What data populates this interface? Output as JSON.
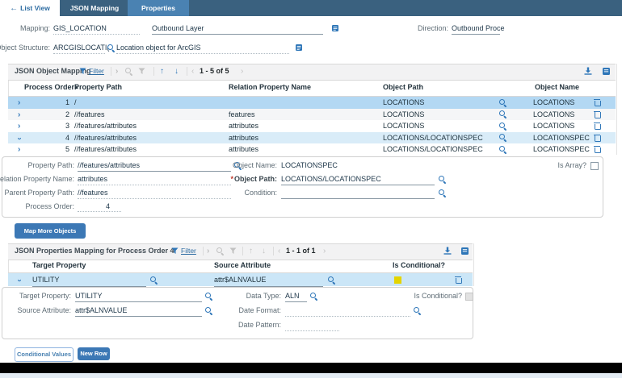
{
  "tabs": {
    "back_label": "List View",
    "json_mapping": "JSON Mapping",
    "properties": "Properties"
  },
  "form": {
    "mapping_label": "Mapping:",
    "mapping_value": "GIS_LOCATION",
    "mapping_desc": "Outbound Layer",
    "direction_label": "Direction:",
    "direction_value": "Outbound Proce",
    "object_structure_label": "Object Structure:",
    "object_structure_value": "ARCGISLOCATI(",
    "object_structure_desc": "Location object for ArcGIS"
  },
  "object_mapping": {
    "title": "JSON Object Mapping",
    "filter_label": "Filter",
    "pagination": "1 - 5 of 5",
    "sort_indicator": "▴",
    "columns": {
      "process_order": "Process Order",
      "property_path": "Property Path",
      "relation": "Relation Property Name",
      "object_path": "Object Path",
      "object_name": "Object Name"
    },
    "rows": [
      {
        "order": "1",
        "path": "/",
        "relation": "",
        "object_path": "LOCATIONS",
        "object_name": "LOCATIONS"
      },
      {
        "order": "2",
        "path": "//features",
        "relation": "features",
        "object_path": "LOCATIONS",
        "object_name": "LOCATIONS"
      },
      {
        "order": "3",
        "path": "//features/attributes",
        "relation": "attributes",
        "object_path": "LOCATIONS",
        "object_name": "LOCATIONS"
      },
      {
        "order": "4",
        "path": "//features/attributes",
        "relation": "attributes",
        "object_path": "LOCATIONS/LOCATIONSPEC",
        "object_name": "LOCATIONSPEC"
      },
      {
        "order": "5",
        "path": "//features/attributes",
        "relation": "attributes",
        "object_path": "LOCATIONS/LOCATIONSPEC",
        "object_name": "LOCATIONSPEC"
      }
    ],
    "detail": {
      "property_path_label": "Property Path:",
      "property_path": "//features/attributes",
      "relation_label": "Relation Property Name:",
      "relation": "attributes",
      "parent_label": "Parent Property Path:",
      "parent": "//features",
      "process_order_label": "Process Order:",
      "process_order": "4",
      "object_name_label": "Object Name:",
      "object_name": "LOCATIONSPEC",
      "required_mark": "*",
      "object_path_label": "Object Path:",
      "object_path": "LOCATIONS/LOCATIONSPEC",
      "condition_label": "Condition:",
      "condition": "",
      "is_array_label": "Is Array?"
    },
    "map_more_label": "Map More Objects"
  },
  "properties_mapping": {
    "title": "JSON Properties Mapping for Process Order 4",
    "filter_label": "Filter",
    "pagination": "1 - 1 of 1",
    "columns": {
      "target": "Target Property",
      "source": "Source Attribute",
      "conditional": "Is Conditional?"
    },
    "rows": [
      {
        "target": "UTILITY",
        "source": "attr$ALNVALUE"
      }
    ],
    "detail": {
      "target_label": "Target Property:",
      "target": "UTILITY",
      "data_type_label": "Data Type:",
      "data_type": "ALN",
      "is_conditional_label": "Is Conditional?",
      "source_label": "Source Attribute:",
      "source": "attr$ALNVALUE",
      "date_format_label": "Date Format:",
      "date_format": "",
      "date_pattern_label": "Date Pattern:",
      "date_pattern": ""
    },
    "footer": {
      "conditional_values": "Conditional Values",
      "new_row": "New Row"
    }
  },
  "colors": {
    "tabbar": "#3a617f",
    "active_tab": "#4a82b2",
    "accent_blue": "#2e76b8",
    "selected_row": "#b3d8f3",
    "expanded_row": "#d9ecf8",
    "properties_row": "#cbe6f7",
    "conditional_yellow": "#e4d400",
    "button_blue": "#3c78b5"
  }
}
